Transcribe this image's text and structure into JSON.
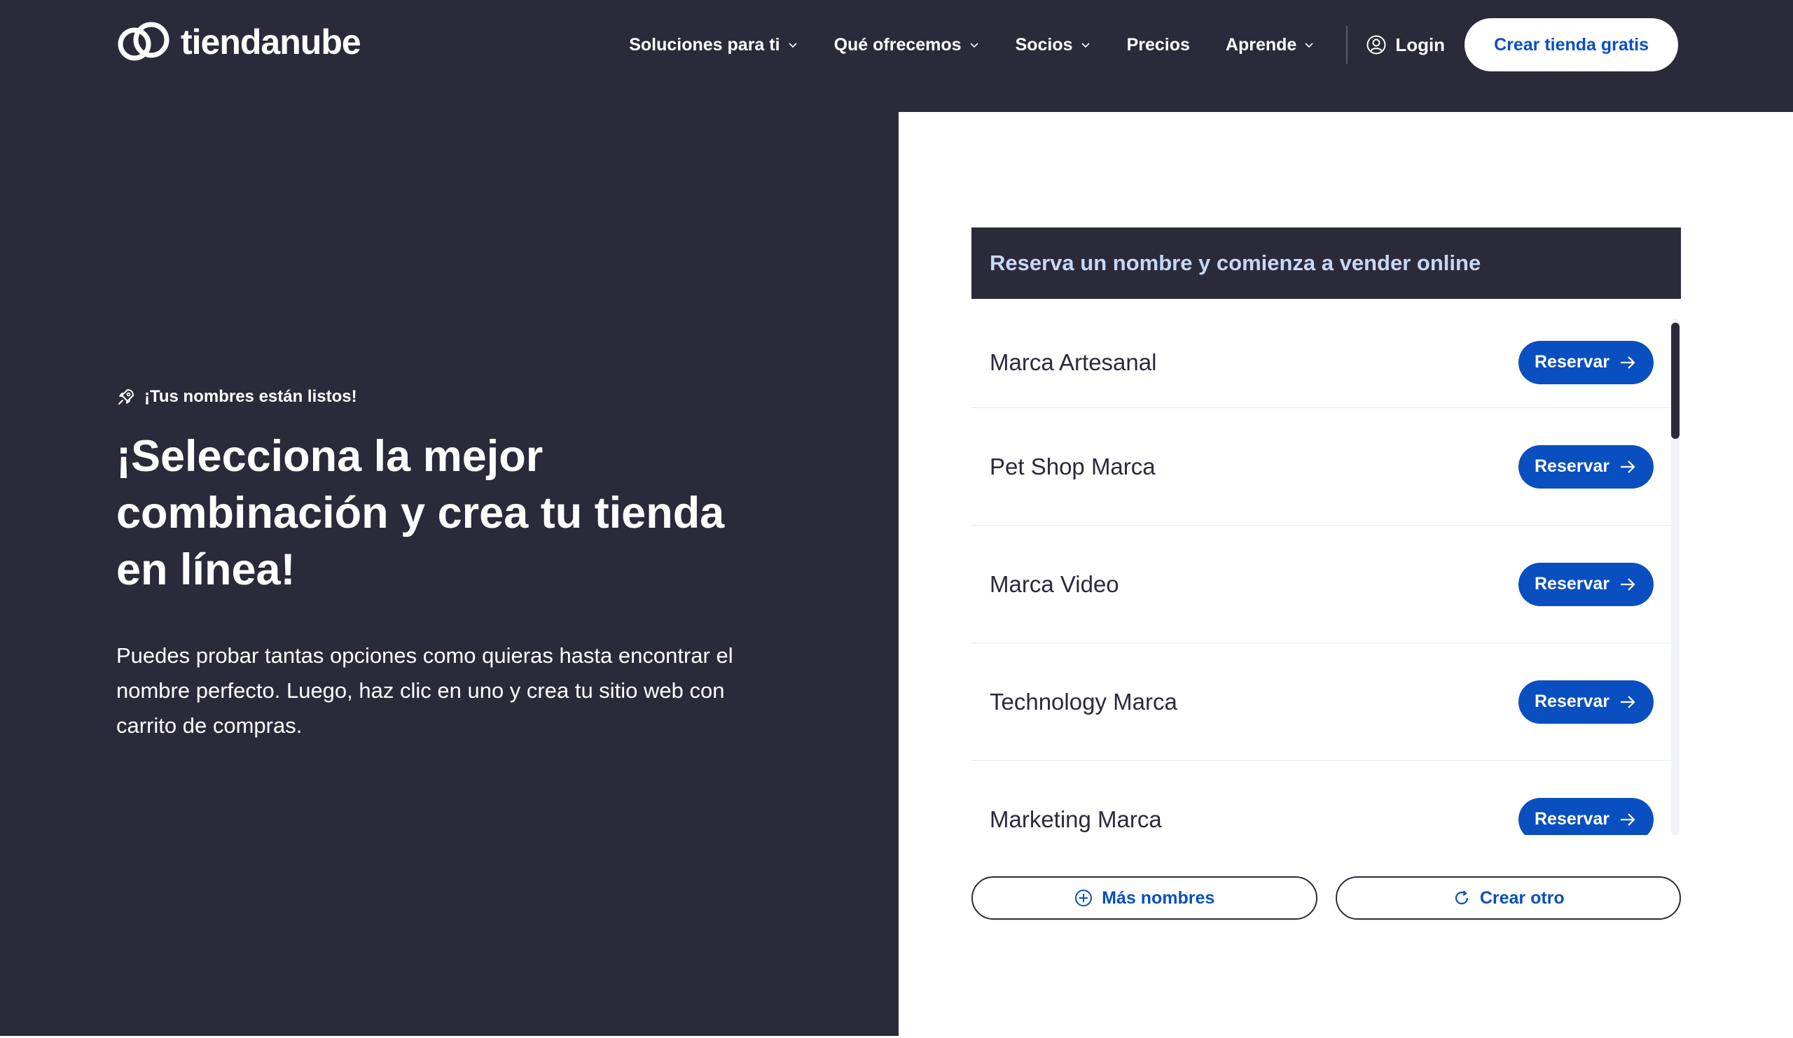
{
  "header": {
    "logo_text": "tiendanube",
    "nav": [
      {
        "label": "Soluciones para ti",
        "icon": "chevron-down-icon"
      },
      {
        "label": "Qué ofrecemos",
        "icon": "chevron-down-icon"
      },
      {
        "label": "Socios",
        "icon": "chevron-down-icon"
      },
      {
        "label": "Precios"
      },
      {
        "label": "Aprende",
        "icon": "chevron-down-icon"
      }
    ],
    "login_label": "Login",
    "cta_label": "Crear tienda gratis"
  },
  "hero": {
    "badge": "¡Tus nombres están listos!",
    "title": "¡Selecciona la mejor combinación y crea tu tienda en línea!",
    "text": "Puedes probar tantas opciones como quieras hasta encontrar el nombre perfecto. Luego, haz clic en uno y crea tu sitio web con carrito de compras."
  },
  "panel": {
    "heading": "Reserva un nombre y comienza a vender online",
    "names": [
      {
        "name": "Marca Artesanal",
        "action": "Reservar"
      },
      {
        "name": "Pet Shop Marca",
        "action": "Reservar"
      },
      {
        "name": "Marca Video",
        "action": "Reservar"
      },
      {
        "name": "Technology Marca",
        "action": "Reservar"
      },
      {
        "name": "Marketing Marca",
        "action": "Reservar"
      }
    ],
    "more_label": "Más nombres",
    "create_label": "Crear otro"
  },
  "colors": {
    "dark": "#2b2a3b",
    "accent": "#0a4fbf",
    "heading_text": "#c7d8f5",
    "white": "#ffffff"
  }
}
